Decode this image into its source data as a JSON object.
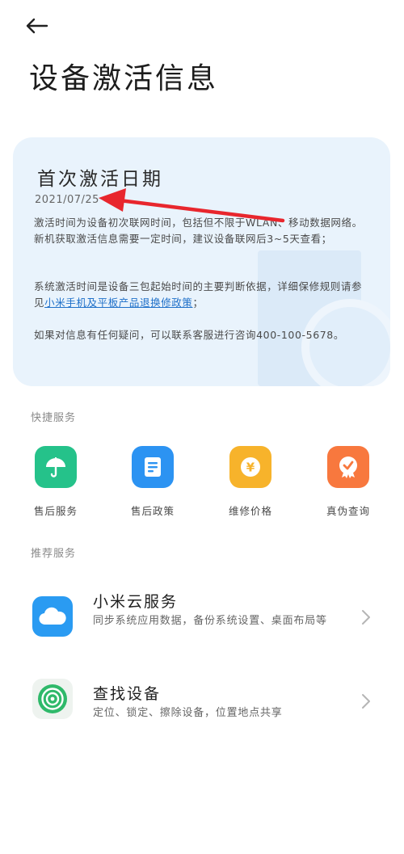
{
  "header": {
    "title": "设备激活信息"
  },
  "card": {
    "title": "首次激活日期",
    "date": "2021/07/25",
    "para1": "激活时间为设备初次联网时间，包括但不限于WLAN、移动数据网络。新机获取激活信息需要一定时间，建议设备联网后3~5天查看；",
    "para2_pre": "系统激活时间是设备三包起始时间的主要判断依据，详细保修规则请参见",
    "para2_link": "小米手机及平板产品退换修政策",
    "para2_post": "；",
    "para3": "如果对信息有任何疑问，可以联系客服进行咨询400-100-5678。"
  },
  "quick_services": {
    "label": "快捷服务",
    "items": [
      {
        "label": "售后服务",
        "icon": "umbrella-icon",
        "color": "#25c28a"
      },
      {
        "label": "售后政策",
        "icon": "document-icon",
        "color": "#2c93f2"
      },
      {
        "label": "维修价格",
        "icon": "yuan-coin-icon",
        "color": "#f7b32b"
      },
      {
        "label": "真伪查询",
        "icon": "verify-badge-icon",
        "color": "#f8783e"
      }
    ]
  },
  "recommended": {
    "label": "推荐服务",
    "items": [
      {
        "title": "小米云服务",
        "desc": "同步系统应用数据，备份系统设置、桌面布局等",
        "icon": "cloud-icon",
        "color": "#2a9bf2"
      },
      {
        "title": "查找设备",
        "desc": "定位、锁定、擦除设备，位置地点共享",
        "icon": "radar-icon",
        "color": "#2fb96a"
      }
    ]
  },
  "colors": {
    "card_bg": "#e9f3fc",
    "annotation_arrow": "#e8262d",
    "link": "#1f70c9"
  }
}
